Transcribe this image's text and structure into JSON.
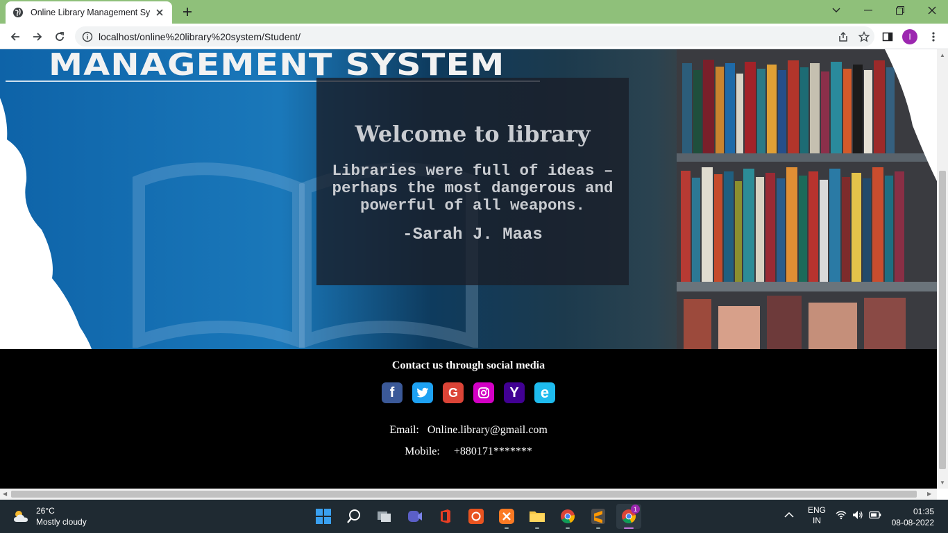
{
  "browser": {
    "tab_title": "Online Library Management Syst",
    "url": "localhost/online%20library%20system/Student/",
    "profile_initial": "I",
    "accent": "#8fc07a"
  },
  "hero": {
    "brand_text": "MANAGEMENT SYSTEM",
    "welcome": "Welcome to library",
    "quote": "Libraries were full of ideas – perhaps the most dangerous and powerful of all weapons.",
    "author": "-Sarah J. Maas"
  },
  "footer": {
    "heading": "Contact us through social media",
    "socials": [
      {
        "name": "facebook-icon",
        "glyph": "f",
        "color": "#3b5998"
      },
      {
        "name": "twitter-icon",
        "glyph": "t",
        "color": "#1da1f2"
      },
      {
        "name": "google-icon",
        "glyph": "G",
        "color": "#db4437"
      },
      {
        "name": "instagram-icon",
        "glyph": "◎",
        "color": "#d300c5"
      },
      {
        "name": "yahoo-icon",
        "glyph": "Y",
        "color": "#410093"
      },
      {
        "name": "internet-explorer-icon",
        "glyph": "e",
        "color": "#1ebbee"
      }
    ],
    "email_label": "Email:",
    "email_value": "Online.library@gmail.com",
    "mobile_label": "Mobile:",
    "mobile_value": "+880171*******"
  },
  "taskbar": {
    "temperature": "26°C",
    "weather": "Mostly cloudy",
    "lang_top": "ENG",
    "lang_bottom": "IN",
    "time": "01:35",
    "date": "08-08-2022",
    "notification_badge": "1"
  }
}
